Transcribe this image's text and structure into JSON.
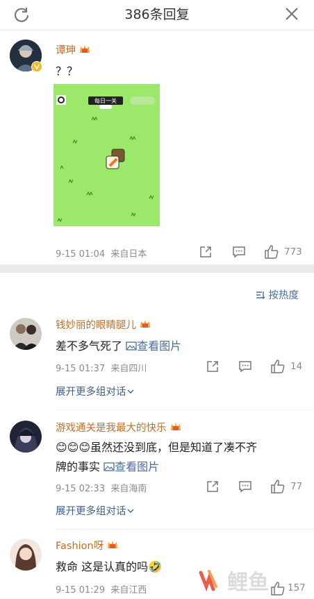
{
  "header": {
    "title": "386条回复",
    "refresh_icon": "refresh-icon",
    "close_icon": "close-icon"
  },
  "post": {
    "username": "谭珅",
    "text": "？？",
    "time": "9-15 01:04",
    "source": "来自日本",
    "like_count": "773",
    "game_label": "每日一关"
  },
  "sort": {
    "label": "按热度"
  },
  "comments": [
    {
      "username": "钱妙丽的眼睛腿儿",
      "text": "差不多气死了 ",
      "link": "查看图片",
      "time": "9-15 01:37",
      "source": "来自四川",
      "like_count": "14",
      "expand": "展开更多组对话"
    },
    {
      "username": "游戏通关是我最大的快乐",
      "text_line1": "😊😊😊虽然还没到底，但是知道了凑不齐",
      "text_line2": "牌的事实 ",
      "link": "查看图片",
      "time": "9-15 02:33",
      "source": "来自海南",
      "like_count": "77",
      "expand": "展开更多组对话"
    },
    {
      "username": "Fashion呀",
      "text": "救命 这是认真的吗🤣",
      "time": "9-15 01:29",
      "source": "来自江西",
      "like_count": "157"
    }
  ],
  "watermark": "鲤鱼"
}
